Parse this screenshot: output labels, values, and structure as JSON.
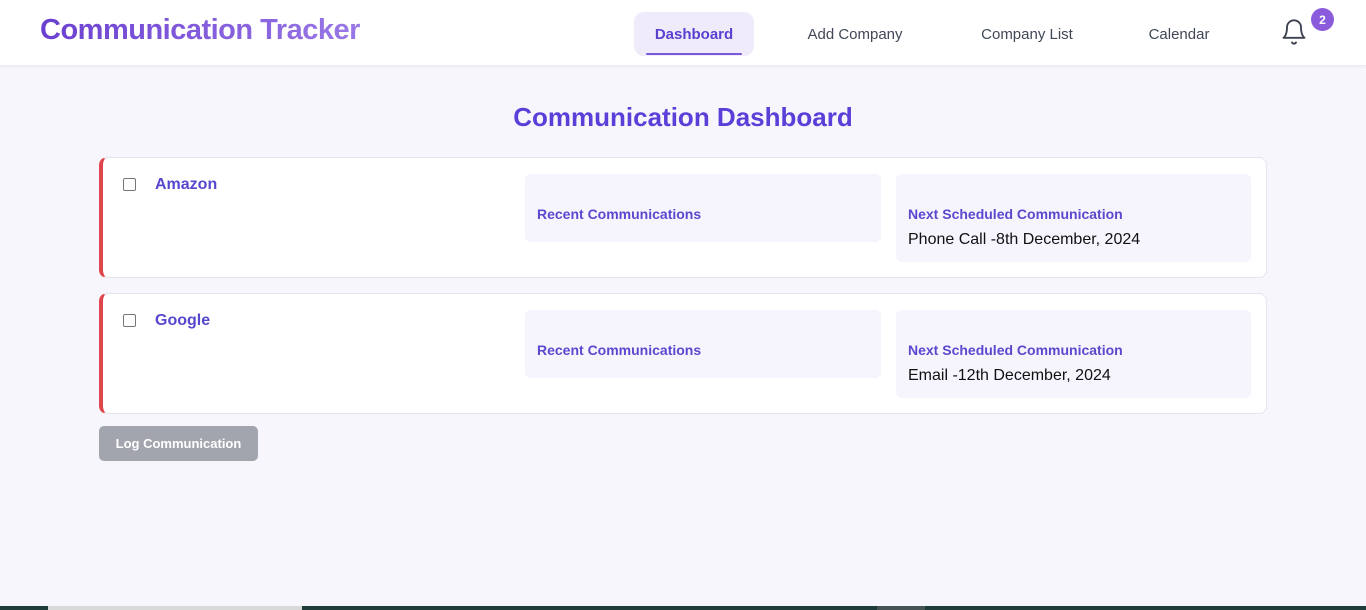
{
  "app": {
    "brand": "Communication Tracker"
  },
  "nav": {
    "items": [
      {
        "label": "Dashboard",
        "active": true
      },
      {
        "label": "Add Company",
        "active": false
      },
      {
        "label": "Company List",
        "active": false
      },
      {
        "label": "Calendar",
        "active": false
      }
    ],
    "notifications": {
      "icon": "bell-icon",
      "count": "2"
    }
  },
  "main": {
    "title": "Communication Dashboard",
    "companies": [
      {
        "name": "Amazon",
        "checked": false,
        "recent_label": "Recent Communications",
        "next_label": "Next Scheduled Communication",
        "next_value": "Phone Call -8th December, 2024"
      },
      {
        "name": "Google",
        "checked": false,
        "recent_label": "Recent Communications",
        "next_label": "Next Scheduled Communication",
        "next_value": "Email -12th December, 2024"
      }
    ],
    "log_button": "Log Communication"
  },
  "colors": {
    "accent": "#5b3fd8",
    "overdue_border": "#e0474c",
    "disabled_button": "#a2a5ae",
    "badge": "#8a5cdb"
  }
}
